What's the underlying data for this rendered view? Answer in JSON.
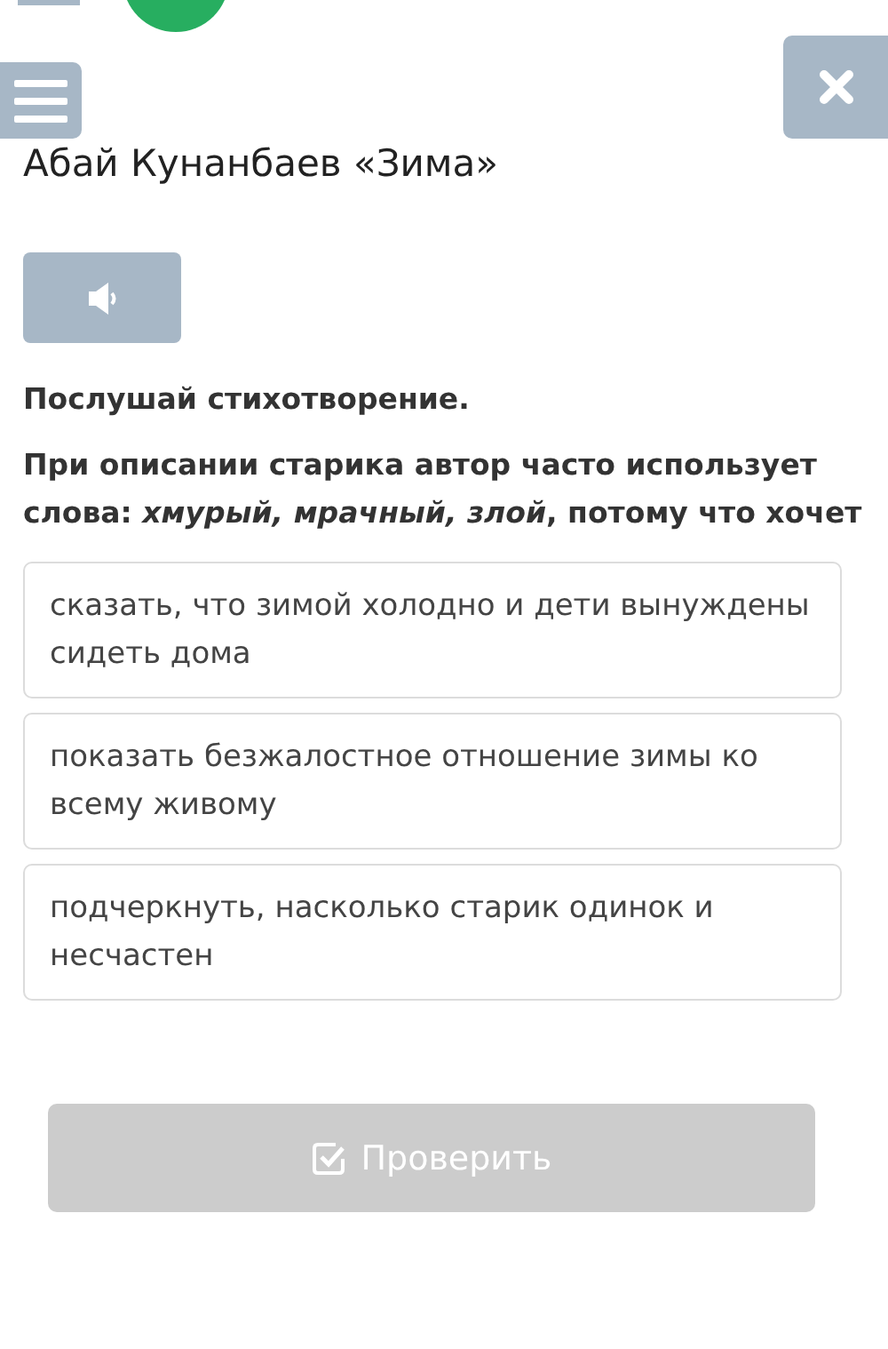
{
  "title": "Абай Кунанбаев «Зима»",
  "instruction": "Послушай стихотворение.",
  "question": "При описании старика автор часто использует слова: *хмурый, мрачный, злой*, потому что хочет",
  "options": [
    {
      "text": "сказать, что зимой холодно и дети вынуждены сидеть дома",
      "selected": false
    },
    {
      "text": "показать безжалостное отношение зимы ко всему живому",
      "selected": false
    },
    {
      "text": "подчеркнуть, насколько старик одинок и несчастен",
      "selected": false
    }
  ],
  "check_button": {
    "label": "Проверить",
    "disabled": true
  }
}
